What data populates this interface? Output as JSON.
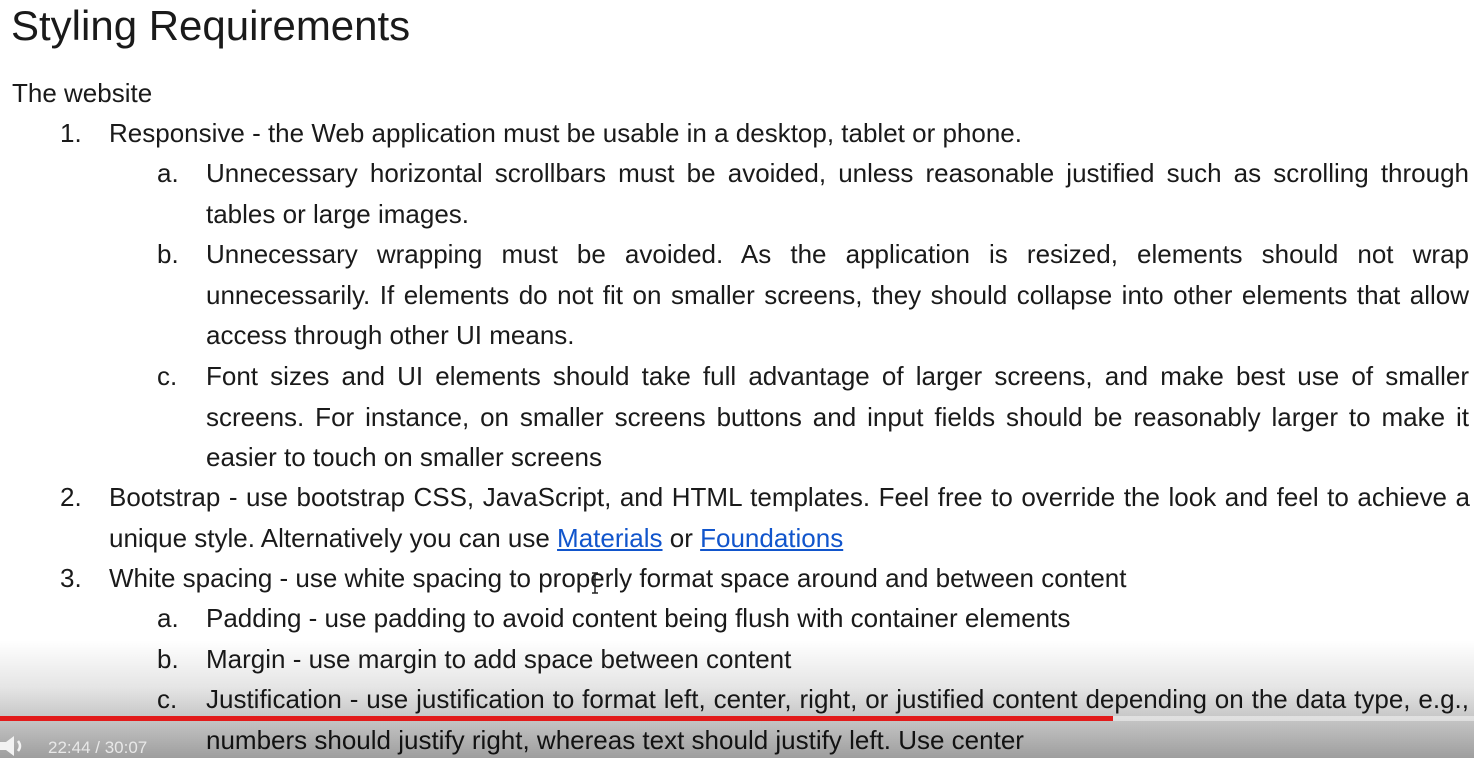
{
  "doc": {
    "title": "Styling Requirements",
    "intro": "The website",
    "items": [
      {
        "marker": "1.",
        "text": "Responsive - the Web application must be usable in a desktop, tablet or phone."
      },
      {
        "marker": "a.",
        "text": "Unnecessary horizontal scrollbars must be avoided, unless reasonable justified such as scrolling through tables or large images."
      },
      {
        "marker": "b.",
        "text": "Unnecessary wrapping must be avoided. As the application is resized, elements should not wrap unnecessarily. If elements do not fit on smaller screens, they should collapse into other elements that allow access through other UI means."
      },
      {
        "marker": "c.",
        "text": "Font sizes and UI elements should take full advantage of larger screens, and make best use of smaller screens. For instance, on smaller screens buttons and input fields should be reasonably larger to make it easier to touch on smaller screens"
      },
      {
        "marker": "2.",
        "text_before": "Bootstrap - use bootstrap CSS, JavaScript, and HTML templates. Feel free to override the look and feel to achieve a unique style. Alternatively you can use ",
        "link1": "Materials",
        "text_mid": " or ",
        "link2": "Foundations"
      },
      {
        "marker": "3.",
        "text": "White spacing - use white spacing to properly format space around and between content"
      },
      {
        "marker": "a.",
        "text": "Padding - use padding to avoid content being flush with container elements"
      },
      {
        "marker": "b.",
        "text": "Margin - use margin to add space between content"
      },
      {
        "marker": "c.",
        "text": "Justification - use justification to format left, center, right, or justified content depending on the data type, e.g., numbers should justify right, whereas text should justify left. Use center"
      }
    ]
  },
  "player": {
    "time_current": "22:44",
    "time_separator": " / ",
    "time_total": "30:07",
    "progress_fraction": 0.755,
    "progress_color": "#e21b1b",
    "volume_icon": "volume-icon"
  }
}
